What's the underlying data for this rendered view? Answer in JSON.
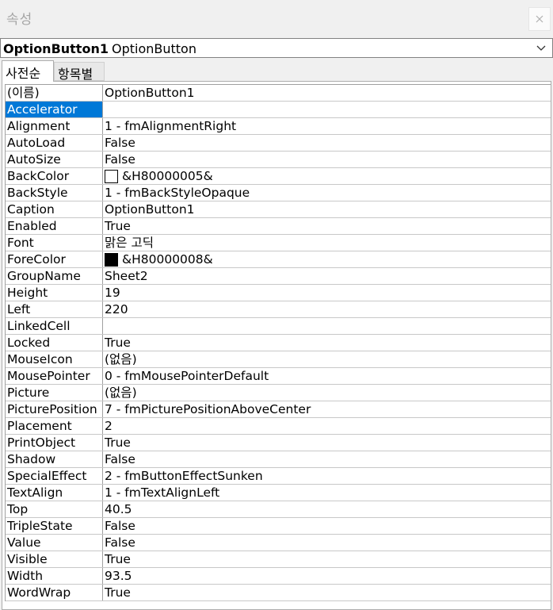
{
  "window": {
    "title": "속성",
    "close_glyph": "×"
  },
  "object_selector": {
    "name": "OptionButton1",
    "type": "OptionButton"
  },
  "tabs": [
    {
      "label": "사전순",
      "active": true
    },
    {
      "label": "항목별",
      "active": false
    }
  ],
  "properties": [
    {
      "name": "(이름)",
      "value": "OptionButton1"
    },
    {
      "name": "Accelerator",
      "value": "",
      "selected": true
    },
    {
      "name": "Alignment",
      "value": "1 - fmAlignmentRight"
    },
    {
      "name": "AutoLoad",
      "value": "False"
    },
    {
      "name": "AutoSize",
      "value": "False"
    },
    {
      "name": "BackColor",
      "value": "&H80000005&",
      "swatch": "#ffffff"
    },
    {
      "name": "BackStyle",
      "value": "1 - fmBackStyleOpaque"
    },
    {
      "name": "Caption",
      "value": "OptionButton1"
    },
    {
      "name": "Enabled",
      "value": "True"
    },
    {
      "name": "Font",
      "value": "맑은 고딕"
    },
    {
      "name": "ForeColor",
      "value": "&H80000008&",
      "swatch": "#000000"
    },
    {
      "name": "GroupName",
      "value": "Sheet2"
    },
    {
      "name": "Height",
      "value": "19"
    },
    {
      "name": "Left",
      "value": "220"
    },
    {
      "name": "LinkedCell",
      "value": ""
    },
    {
      "name": "Locked",
      "value": "True"
    },
    {
      "name": "MouseIcon",
      "value": "(없음)"
    },
    {
      "name": "MousePointer",
      "value": "0 - fmMousePointerDefault"
    },
    {
      "name": "Picture",
      "value": "(없음)"
    },
    {
      "name": "PicturePosition",
      "value": "7 - fmPicturePositionAboveCenter"
    },
    {
      "name": "Placement",
      "value": "2"
    },
    {
      "name": "PrintObject",
      "value": "True"
    },
    {
      "name": "Shadow",
      "value": "False"
    },
    {
      "name": "SpecialEffect",
      "value": "2 - fmButtonEffectSunken"
    },
    {
      "name": "TextAlign",
      "value": "1 - fmTextAlignLeft"
    },
    {
      "name": "Top",
      "value": "40.5"
    },
    {
      "name": "TripleState",
      "value": "False"
    },
    {
      "name": "Value",
      "value": "False"
    },
    {
      "name": "Visible",
      "value": "True"
    },
    {
      "name": "Width",
      "value": "93.5"
    },
    {
      "name": "WordWrap",
      "value": "True"
    }
  ],
  "colors": {
    "selection": "#0078d7",
    "grid_line": "#c8c8c8"
  }
}
